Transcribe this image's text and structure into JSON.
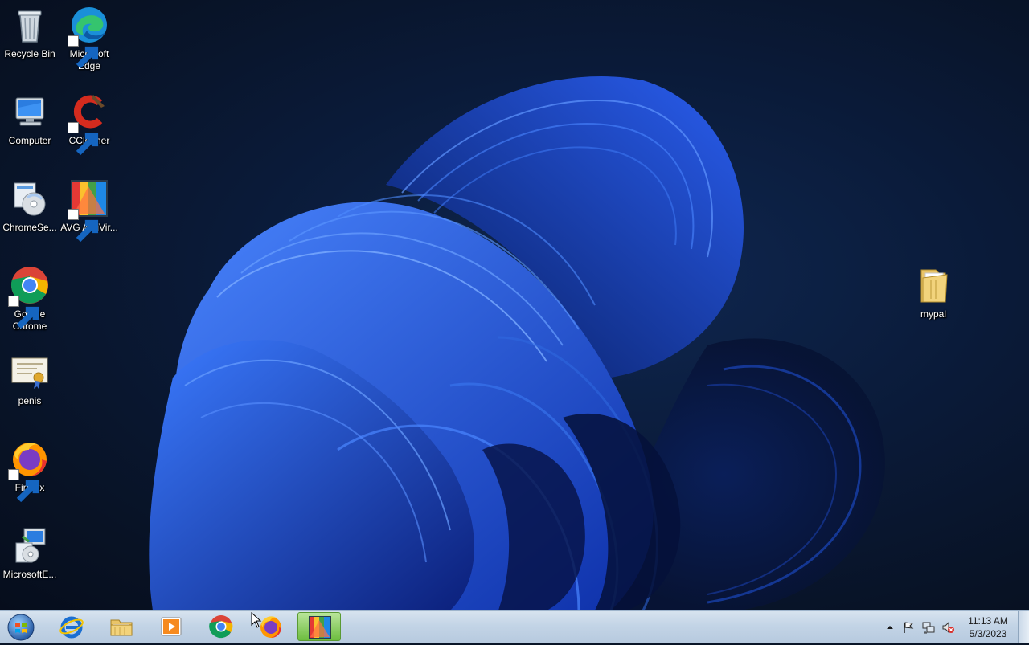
{
  "desktop": {
    "icons": [
      {
        "label": "Recycle Bin",
        "icon": "recycle-bin-icon"
      },
      {
        "label": "Microsoft Edge",
        "icon": "edge-icon"
      },
      {
        "label": "Computer",
        "icon": "computer-icon"
      },
      {
        "label": "CCleaner",
        "icon": "ccleaner-icon"
      },
      {
        "label": "ChromeSe...",
        "icon": "installer-icon"
      },
      {
        "label": "AVG AntiVir...",
        "icon": "avg-icon"
      },
      {
        "label": "Google Chrome",
        "icon": "chrome-icon"
      },
      {
        "label": "penis",
        "icon": "certificate-icon"
      },
      {
        "label": "Firefox",
        "icon": "firefox-icon"
      },
      {
        "label": "MicrosoftE...",
        "icon": "installer-icon"
      },
      {
        "label": "mypal",
        "icon": "folder-icon"
      }
    ]
  },
  "taskbar": {
    "start": "start-orb-icon",
    "pinned": [
      {
        "name": "Internet Explorer",
        "icon": "ie-icon"
      },
      {
        "name": "File Explorer",
        "icon": "folder-icon"
      },
      {
        "name": "Media Player",
        "icon": "media-player-icon"
      },
      {
        "name": "Google Chrome",
        "icon": "chrome-icon"
      },
      {
        "name": "Firefox",
        "icon": "firefox-icon"
      },
      {
        "name": "AVG",
        "icon": "avg-icon",
        "active": true
      }
    ],
    "tray": {
      "icons": [
        "show-hidden-icon",
        "action-center-flag-icon",
        "network-icon",
        "volume-muted-icon"
      ],
      "time": "11:13 AM",
      "date": "5/3/2023"
    }
  },
  "colors": {
    "wallpaper_bloom": "#1e55e8",
    "wallpaper_bg": "#0a1a38",
    "taskbar": "#c3d4e6"
  }
}
